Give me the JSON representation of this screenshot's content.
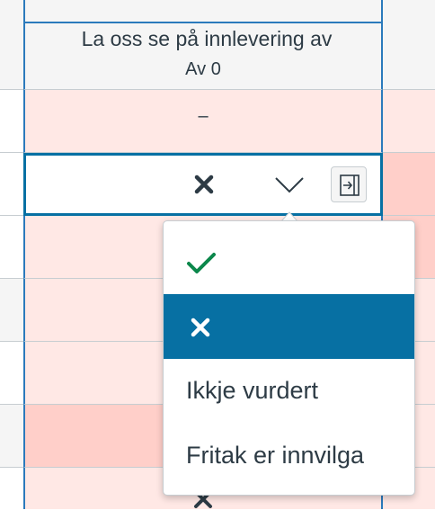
{
  "header": {
    "assignment_title": "La oss se på innlevering av",
    "points_possible": "Av 0"
  },
  "grid": {
    "empty_grade": "–"
  },
  "grade_editor": {
    "clear_icon": "x-icon",
    "dropdown_icon": "chevron-down-icon",
    "tray_icon": "open-tray-icon"
  },
  "grade_menu": {
    "items": [
      {
        "icon": "check-icon",
        "label": "",
        "selected": false
      },
      {
        "icon": "x-icon",
        "label": "",
        "selected": true
      },
      {
        "icon": "",
        "label": "Ikkje vurdert",
        "selected": false
      },
      {
        "icon": "",
        "label": "Fritak er innvilga",
        "selected": false
      }
    ]
  },
  "colors": {
    "accent_blue": "#0770a3",
    "check_green": "#0b874b",
    "late_row_pink": "#ffe8e5",
    "missing_row_pink": "#ffcfc9",
    "text": "#2d3b45"
  }
}
